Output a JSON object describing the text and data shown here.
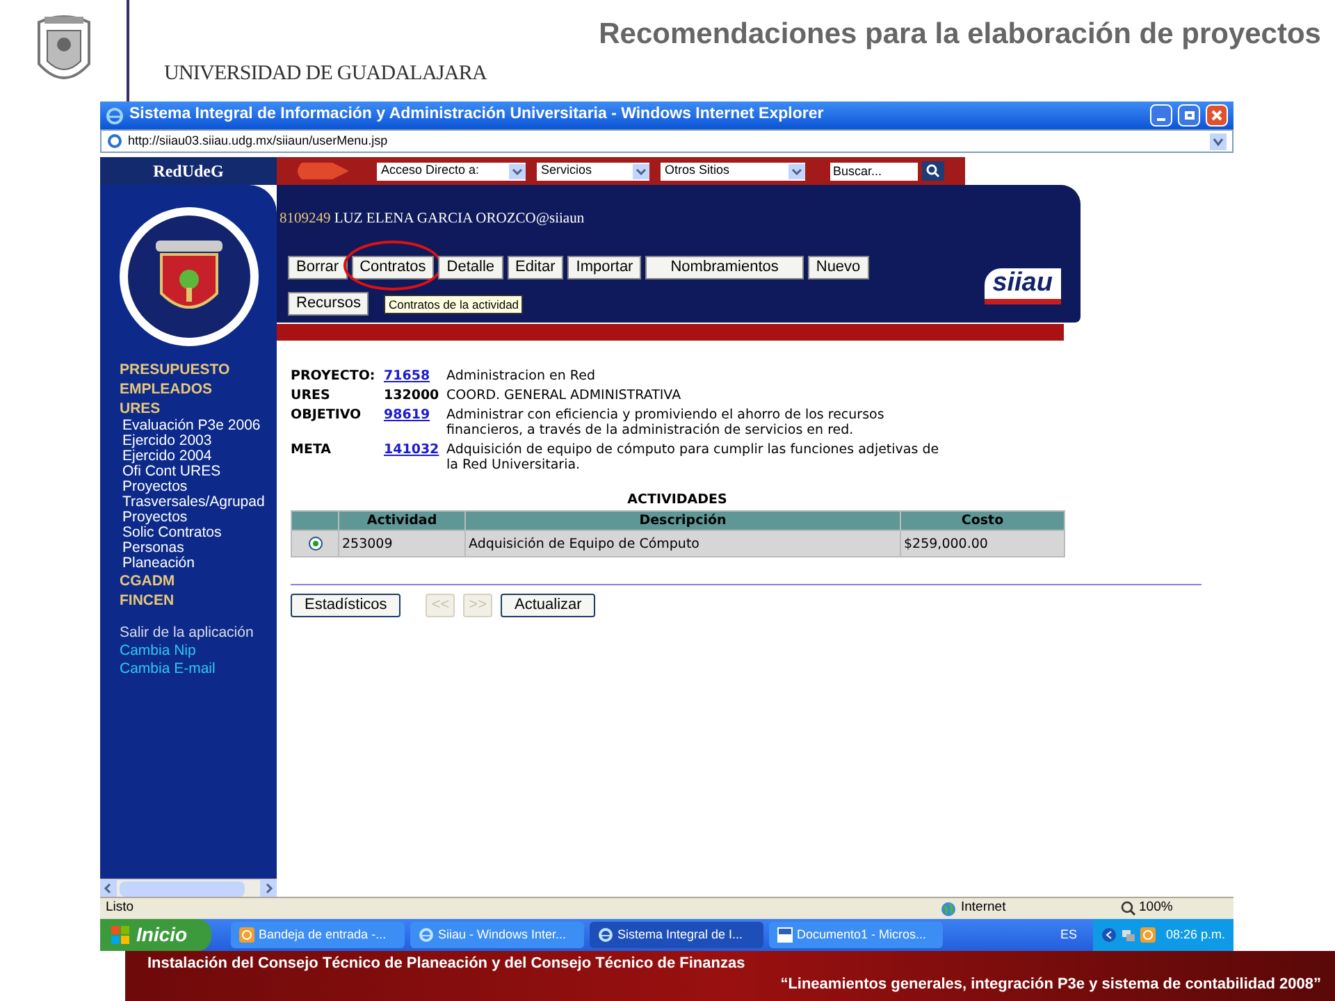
{
  "slide": {
    "title": "Recomendaciones para la elaboración de proyectos",
    "university": "UNIVERSIDAD DE GUADALAJARA"
  },
  "window": {
    "title": "Sistema Integral de Información y Administración Universitaria - Windows Internet Explorer",
    "address": "http://siiau03.siiau.udg.mx/siiaun/userMenu.jsp"
  },
  "toolbar": {
    "logo": "RedUdeG",
    "dropdowns": [
      "Acceso Directo a:",
      "Servicios",
      "Otros Sitios"
    ],
    "search": "Buscar..."
  },
  "header": {
    "user_id": "8109249",
    "user_name": "LUZ ELENA GARCIA OROZCO@siiaun",
    "buttons": [
      {
        "label": "Borrar",
        "circled": false
      },
      {
        "label": "Contratos",
        "circled": true
      },
      {
        "label": "Detalle",
        "circled": false
      },
      {
        "label": "Editar",
        "circled": false
      },
      {
        "label": "Importar",
        "circled": false
      },
      {
        "label": "Nombramientos",
        "circled": false
      },
      {
        "label": "Nuevo",
        "circled": false
      },
      {
        "label": "Recursos",
        "circled": false
      }
    ],
    "tooltip": "Contratos de la actividad",
    "logo": "siiau"
  },
  "sidebar": {
    "items": [
      {
        "kind": "section",
        "label": "PRESUPUESTO"
      },
      {
        "kind": "section",
        "label": "EMPLEADOS"
      },
      {
        "kind": "section",
        "label": "URES",
        "children": [
          {
            "label": "Evaluación P3e 2006"
          },
          {
            "label": "Ejercido 2003"
          },
          {
            "label": "Ejercido 2004"
          },
          {
            "label": "Ofi Cont URES"
          },
          {
            "label": "Proyectos"
          },
          {
            "label": "Trasversales/Agrupad"
          },
          {
            "label": "Proyectos"
          },
          {
            "label": "Solic Contratos"
          },
          {
            "label": "Personas"
          },
          {
            "label": "Planeación"
          }
        ]
      },
      {
        "kind": "section",
        "label": "CGADM"
      },
      {
        "kind": "section",
        "label": "FINCEN"
      },
      {
        "kind": "action",
        "label": "Salir de la aplicación"
      },
      {
        "kind": "link",
        "label": "Cambia Nip"
      },
      {
        "kind": "link",
        "label": "Cambia E-mail"
      }
    ]
  },
  "project": [
    {
      "label": "PROYECTO:",
      "code": "71658",
      "linked": true,
      "value": "Administracion en Red"
    },
    {
      "label": "URES",
      "code": "132000",
      "linked": false,
      "value": "COORD. GENERAL ADMINISTRATIVA"
    },
    {
      "label": "OBJETIVO",
      "code": "98619",
      "linked": true,
      "value": "Administrar con eficiencia y promiviendo el ahorro de los recursos financieros, a través de la administración de servicios en red."
    },
    {
      "label": "META",
      "code": "141032",
      "linked": true,
      "value": "Adquisición de equipo de cómputo para cumplir las funciones adjetivas de la Red Universitaria."
    }
  ],
  "table": {
    "title": "ACTIVIDADES",
    "columns": [
      "Actividad",
      "Descripción",
      "Costo"
    ],
    "rows": [
      {
        "selected": true,
        "cells": [
          "253009",
          "Adquisición de Equipo de Cómputo",
          "$259,000.00"
        ]
      }
    ]
  },
  "actions": [
    {
      "label": "Estadísticos",
      "disabled": false
    },
    {
      "label": "<<",
      "disabled": true
    },
    {
      "label": ">>",
      "disabled": true
    },
    {
      "label": "Actualizar",
      "disabled": false
    }
  ],
  "status_bar": {
    "text": "Listo",
    "zone": "Internet",
    "zoom": "100%"
  },
  "taskbar": {
    "start": "Inicio",
    "tasks": [
      {
        "kind": "mail",
        "label": "Bandeja de entrada -...",
        "selected": false
      },
      {
        "kind": "browser",
        "label": "Siiau - Windows Inter...",
        "selected": false
      },
      {
        "kind": "browser",
        "label": "Sistema Integral de I...",
        "selected": true
      },
      {
        "kind": "document",
        "label": "Documento1 - Micros...",
        "selected": false
      }
    ],
    "language": "ES",
    "clock": "08:26 p.m."
  },
  "footer": {
    "event": "Instalación del Consejo Técnico de Planeación y del Consejo Técnico de Finanzas",
    "subtitle": "“Lineamientos generales, integración P3e y sistema de contabilidad 2008”"
  }
}
